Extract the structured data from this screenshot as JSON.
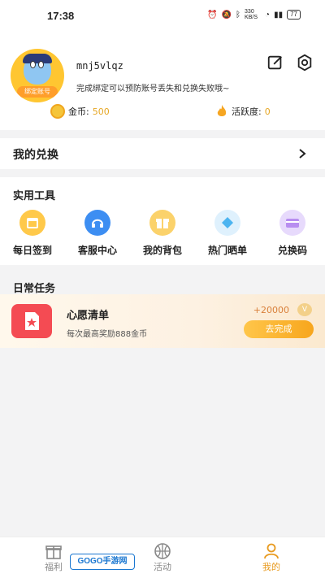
{
  "status_bar": {
    "time": "17:38",
    "speed": "330 KB/S",
    "battery": "77"
  },
  "profile": {
    "username": "mnj5vlqz",
    "avatar_tag": "绑定账号",
    "hint": "完成绑定可以预防账号丢失和兑换失败哦~"
  },
  "stats": {
    "coins_label": "金币:",
    "coins_value": "500",
    "activity_label": "活跃度:",
    "activity_value": "0"
  },
  "exchange": {
    "title": "我的兑换"
  },
  "tools": {
    "title": "实用工具",
    "items": [
      {
        "label": "每日签到",
        "icon": "calendar-icon",
        "color": "#ffc94a"
      },
      {
        "label": "客服中心",
        "icon": "headset-icon",
        "color": "#3d8ef2"
      },
      {
        "label": "我的背包",
        "icon": "gift-icon",
        "color": "#fbd26b"
      },
      {
        "label": "热门晒单",
        "icon": "diamond-icon",
        "color": "#4cb4f0"
      },
      {
        "label": "兑换码",
        "icon": "card-icon",
        "color": "#b88ef0"
      }
    ]
  },
  "tasks": {
    "title": "日常任务",
    "items": [
      {
        "title": "心愿清单",
        "subtitle": "每次最高奖励888金币",
        "reward": "+20000",
        "button": "去完成"
      }
    ]
  },
  "nav": {
    "items": [
      {
        "label": "福利",
        "icon": "gift-icon",
        "active": false
      },
      {
        "label": "活动",
        "icon": "basketball-icon",
        "active": false
      },
      {
        "label": "我的",
        "icon": "user-icon",
        "active": true
      }
    ]
  },
  "watermark": "GOGO手游网",
  "colors": {
    "accent": "#f7a61d",
    "coin": "#e6a623",
    "task_icon": "#f44b53"
  }
}
